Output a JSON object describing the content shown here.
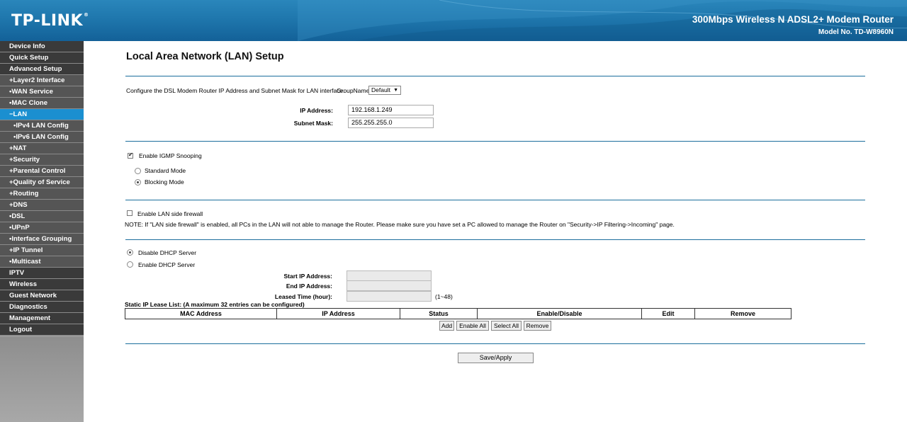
{
  "header": {
    "logo": "TP-LINK",
    "logo_reg": "®",
    "product": "300Mbps Wireless N ADSL2+ Modem Router",
    "model": "Model No. TD-W8960N"
  },
  "sidebar": {
    "items": [
      {
        "label": "Device Info",
        "level": "top"
      },
      {
        "label": "Quick Setup",
        "level": "top"
      },
      {
        "label": "Advanced Setup",
        "level": "top"
      },
      {
        "label": "+Layer2 Interface",
        "level": "sub"
      },
      {
        "label": "•WAN Service",
        "level": "sub"
      },
      {
        "label": "•MAC Clone",
        "level": "sub"
      },
      {
        "label": "−LAN",
        "level": "sub",
        "active": true
      },
      {
        "label": "•IPv4 LAN Config",
        "level": "sub2"
      },
      {
        "label": "•IPv6 LAN Config",
        "level": "sub2"
      },
      {
        "label": "+NAT",
        "level": "sub"
      },
      {
        "label": "+Security",
        "level": "sub"
      },
      {
        "label": "+Parental Control",
        "level": "sub"
      },
      {
        "label": "+Quality of Service",
        "level": "sub"
      },
      {
        "label": "+Routing",
        "level": "sub"
      },
      {
        "label": "+DNS",
        "level": "sub"
      },
      {
        "label": "•DSL",
        "level": "sub"
      },
      {
        "label": "•UPnP",
        "level": "sub"
      },
      {
        "label": "•Interface Grouping",
        "level": "sub"
      },
      {
        "label": "+IP Tunnel",
        "level": "sub"
      },
      {
        "label": "•Multicast",
        "level": "sub"
      },
      {
        "label": "IPTV",
        "level": "top"
      },
      {
        "label": "Wireless",
        "level": "top"
      },
      {
        "label": "Guest Network",
        "level": "top"
      },
      {
        "label": "Diagnostics",
        "level": "top"
      },
      {
        "label": "Management",
        "level": "top"
      },
      {
        "label": "Logout",
        "level": "top"
      }
    ]
  },
  "main": {
    "title": "Local Area Network (LAN) Setup",
    "intro": "Configure the DSL Modem Router IP Address and Subnet Mask for LAN interface.",
    "group_name_label": "GroupName",
    "group_name_value": "Default",
    "ip_address_label": "IP Address:",
    "ip_address_value": "192.168.1.249",
    "subnet_mask_label": "Subnet Mask:",
    "subnet_mask_value": "255.255.255.0",
    "igmp_label": "Enable IGMP Snooping",
    "igmp_checked": true,
    "standard_mode_label": "Standard Mode",
    "blocking_mode_label": "Blocking Mode",
    "igmp_mode": "Blocking Mode",
    "lan_firewall_label": "Enable LAN side firewall",
    "lan_firewall_checked": false,
    "note": "NOTE: If \"LAN side firewall\" is enabled, all PCs in the LAN will not able to manage the Router. Please make sure you have set a PC allowed to manage the Router on \"Security->IP Filtering->Incoming\" page.",
    "disable_dhcp_label": "Disable DHCP Server",
    "enable_dhcp_label": "Enable DHCP Server",
    "dhcp_mode": "Disable DHCP Server",
    "start_ip_label": "Start IP Address:",
    "start_ip_value": "",
    "end_ip_label": "End IP Address:",
    "end_ip_value": "",
    "leased_time_label": "Leased Time (hour):",
    "leased_time_value": "",
    "leased_time_hint": "(1~48)",
    "static_list_label": "Static IP Lease List: (A maximum 32 entries can be configured)",
    "table_headers": [
      "MAC Address",
      "IP Address",
      "Status",
      "Enable/Disable",
      "Edit",
      "Remove"
    ],
    "buttons": {
      "add": "Add",
      "enable_all": "Enable All",
      "select_all": "Select All",
      "remove": "Remove",
      "save_apply": "Save/Apply"
    }
  },
  "colors": {
    "header_blue": "#1f77ad",
    "nav_active": "#1b8fd0",
    "nav_dark": "#3a3a3a",
    "nav_sub": "#555555",
    "divider": "#1b6e9c"
  }
}
